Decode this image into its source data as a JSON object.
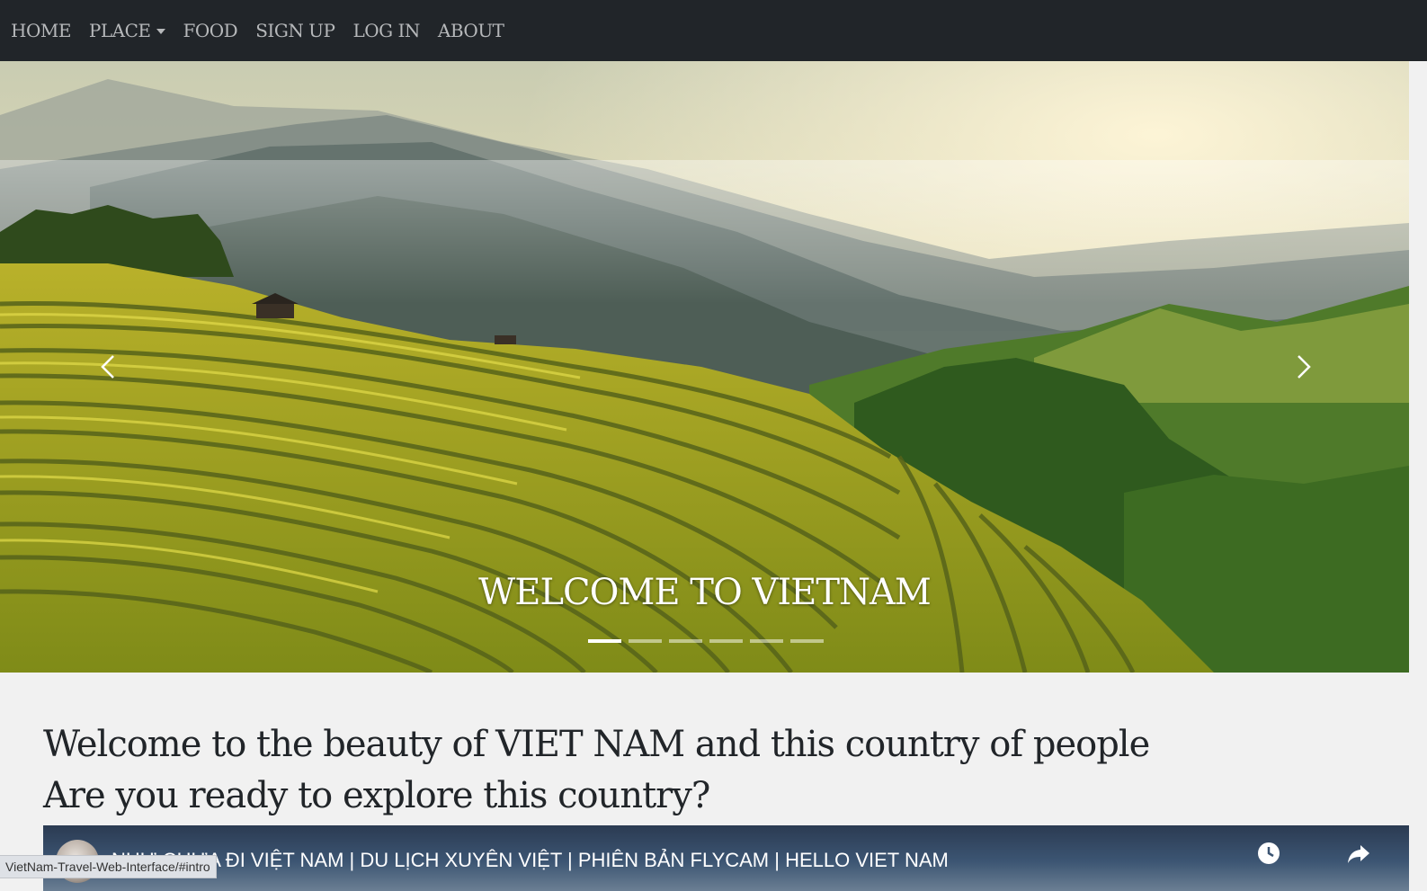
{
  "nav": {
    "items": [
      {
        "label": "HOME"
      },
      {
        "label": "PLACE",
        "dropdown": true
      },
      {
        "label": "FOOD"
      },
      {
        "label": "SIGN UP"
      },
      {
        "label": "LOG IN"
      },
      {
        "label": "ABOUT"
      }
    ]
  },
  "carousel": {
    "caption": "WELCOME TO VIETNAM",
    "slide_count": 6,
    "active_index": 0,
    "prev_icon": "chevron-left-icon",
    "next_icon": "chevron-right-icon"
  },
  "intro": {
    "line1": "Welcome to the beauty of VIET NAM and this country of people",
    "line2": "Are you ready to explore this country?"
  },
  "video": {
    "title": "NHƯ CHƯA ĐI VIỆT NAM | DU LỊCH XUYÊN VIỆT | PHIÊN BẢN FLYCAM | HELLO VIET NAM",
    "icons": [
      "clock-icon",
      "share-icon"
    ]
  },
  "status_bar": {
    "url": "VietNam-Travel-Web-Interface/#intro"
  },
  "colors": {
    "navbar_bg": "#212529",
    "nav_text": "#b6b8ba",
    "page_bg": "#f1f1f1",
    "heading_text": "#212529"
  }
}
